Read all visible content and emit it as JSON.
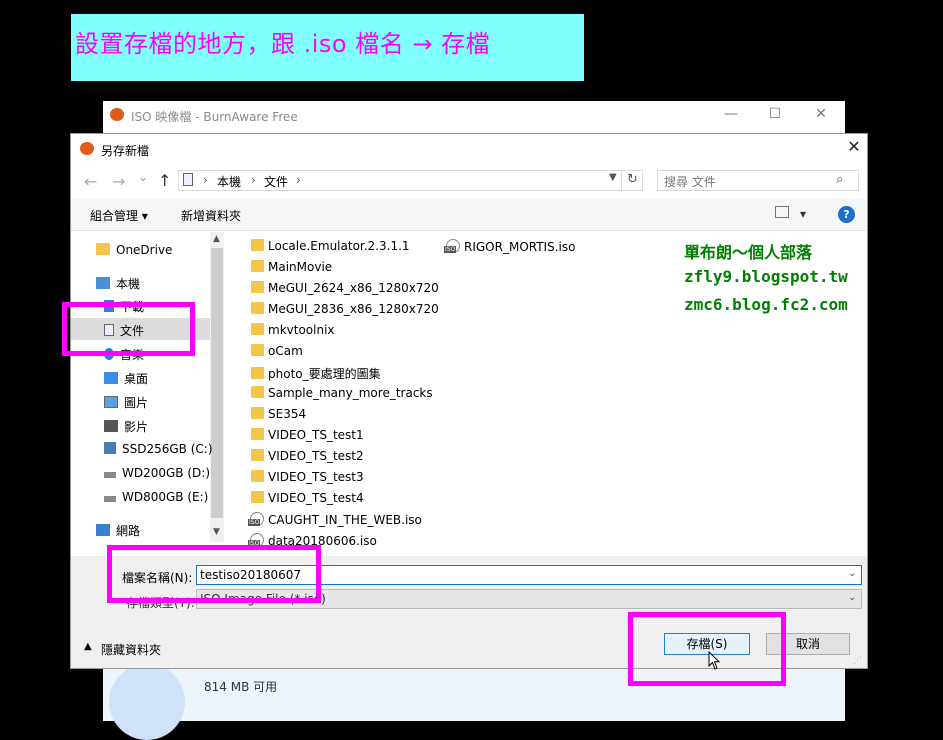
{
  "banner": {
    "text": "設置存檔的地方，跟 .iso 檔名 → 存檔"
  },
  "bg_window": {
    "title": "ISO 映像檔 - BurnAware Free",
    "minimize": "—",
    "maximize": "☐",
    "close": "✕",
    "free_space": "814 MB 可用"
  },
  "dialog": {
    "title": "另存新檔",
    "close": "✕",
    "nav": {
      "back": "←",
      "forward": "→",
      "dropdown": "⌄",
      "up": "↑",
      "refresh": "↻"
    },
    "breadcrumb": [
      "本機",
      "文件"
    ],
    "breadcrumb_sep": "›",
    "search_placeholder": "搜尋 文件",
    "toolbar": {
      "organize": "組合管理 ▾",
      "new_folder": "新增資料夾",
      "view": "▾",
      "help": "?"
    },
    "nav_items": [
      {
        "label": "OneDrive",
        "icon": "folder-icon"
      },
      {
        "label": "本機",
        "icon": "computer-icon"
      },
      {
        "label": "下載",
        "icon": "download-icon"
      },
      {
        "label": "文件",
        "icon": "documents-icon",
        "selected": true
      },
      {
        "label": "音樂",
        "icon": "music-icon"
      },
      {
        "label": "桌面",
        "icon": "desktop-icon"
      },
      {
        "label": "圖片",
        "icon": "pictures-icon"
      },
      {
        "label": "影片",
        "icon": "videos-icon"
      },
      {
        "label": "SSD256GB (C:)",
        "icon": "drive-icon"
      },
      {
        "label": "WD200GB (D:)",
        "icon": "drive-icon"
      },
      {
        "label": "WD800GB (E:)",
        "icon": "drive-icon"
      },
      {
        "label": "網路",
        "icon": "network-icon"
      }
    ],
    "files_col1": [
      {
        "name": "Locale.Emulator.2.3.1.1",
        "type": "folder"
      },
      {
        "name": "MainMovie",
        "type": "folder"
      },
      {
        "name": "MeGUI_2624_x86_1280x720",
        "type": "folder"
      },
      {
        "name": "MeGUI_2836_x86_1280x720",
        "type": "folder"
      },
      {
        "name": "mkvtoolnix",
        "type": "folder"
      },
      {
        "name": "oCam",
        "type": "folder"
      },
      {
        "name": "photo_要處理的圖集",
        "type": "folder"
      },
      {
        "name": "Sample_many_more_tracks",
        "type": "folder"
      },
      {
        "name": "SE354",
        "type": "folder"
      },
      {
        "name": "VIDEO_TS_test1",
        "type": "folder"
      },
      {
        "name": "VIDEO_TS_test2",
        "type": "folder"
      },
      {
        "name": "VIDEO_TS_test3",
        "type": "folder"
      },
      {
        "name": "VIDEO_TS_test4",
        "type": "folder"
      },
      {
        "name": "CAUGHT_IN_THE_WEB.iso",
        "type": "iso"
      },
      {
        "name": "data20180606.iso",
        "type": "iso"
      }
    ],
    "files_col2": [
      {
        "name": "RIGOR_MORTIS.iso",
        "type": "iso"
      }
    ],
    "filename_label": "檔案名稱(N):",
    "filename_value": "testiso20180607",
    "filetype_label": "存檔類型(T):",
    "filetype_value": "ISO Image File (*.iso)",
    "hide_folders": "隱藏資料夾",
    "save_button": "存檔(S)",
    "cancel_button": "取消"
  },
  "watermark": [
    "單布朗～個人部落",
    "zfly9.blogspot.tw",
    "zmc6.blog.fc2.com"
  ],
  "colors": {
    "highlight": "#ff00ff",
    "banner_bg": "#80ffff",
    "watermark": "#008000",
    "accent": "#1a6fcf"
  }
}
